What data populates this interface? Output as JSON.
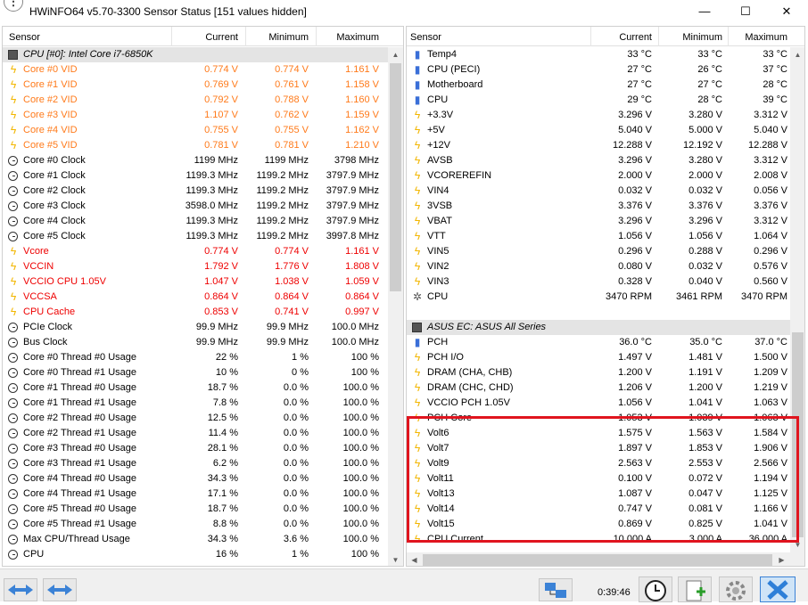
{
  "window": {
    "title": "HWiNFO64 v5.70-3300 Sensor Status [151 values hidden]",
    "minimize": "—",
    "maximize": "☐",
    "close": "✕"
  },
  "columns": {
    "sensor": "Sensor",
    "current": "Current",
    "minimum": "Minimum",
    "maximum": "Maximum"
  },
  "left_rows": [
    {
      "type": "group",
      "icon": "chip",
      "name": "CPU [#0]: Intel Core i7-6850K",
      "cur": "",
      "min": "",
      "max": ""
    },
    {
      "icon": "bolt",
      "color": "orange",
      "name": "Core #0 VID",
      "cur": "0.774 V",
      "min": "0.774 V",
      "max": "1.161 V"
    },
    {
      "icon": "bolt",
      "color": "orange",
      "name": "Core #1 VID",
      "cur": "0.769 V",
      "min": "0.761 V",
      "max": "1.158 V"
    },
    {
      "icon": "bolt",
      "color": "orange",
      "name": "Core #2 VID",
      "cur": "0.792 V",
      "min": "0.788 V",
      "max": "1.160 V"
    },
    {
      "icon": "bolt",
      "color": "orange",
      "name": "Core #3 VID",
      "cur": "1.107 V",
      "min": "0.762 V",
      "max": "1.159 V"
    },
    {
      "icon": "bolt",
      "color": "orange",
      "name": "Core #4 VID",
      "cur": "0.755 V",
      "min": "0.755 V",
      "max": "1.162 V"
    },
    {
      "icon": "bolt",
      "color": "orange",
      "name": "Core #5 VID",
      "cur": "0.781 V",
      "min": "0.781 V",
      "max": "1.210 V"
    },
    {
      "icon": "clock",
      "color": "",
      "name": "Core #0 Clock",
      "cur": "1199 MHz",
      "min": "1199 MHz",
      "max": "3798 MHz"
    },
    {
      "icon": "clock",
      "color": "",
      "name": "Core #1 Clock",
      "cur": "1199.3 MHz",
      "min": "1199.2 MHz",
      "max": "3797.9 MHz"
    },
    {
      "icon": "clock",
      "color": "",
      "name": "Core #2 Clock",
      "cur": "1199.3 MHz",
      "min": "1199.2 MHz",
      "max": "3797.9 MHz"
    },
    {
      "icon": "clock",
      "color": "",
      "name": "Core #3 Clock",
      "cur": "3598.0 MHz",
      "min": "1199.2 MHz",
      "max": "3797.9 MHz"
    },
    {
      "icon": "clock",
      "color": "",
      "name": "Core #4 Clock",
      "cur": "1199.3 MHz",
      "min": "1199.2 MHz",
      "max": "3797.9 MHz"
    },
    {
      "icon": "clock",
      "color": "",
      "name": "Core #5 Clock",
      "cur": "1199.3 MHz",
      "min": "1199.2 MHz",
      "max": "3997.8 MHz"
    },
    {
      "icon": "bolt",
      "color": "red",
      "name": "Vcore",
      "cur": "0.774 V",
      "min": "0.774 V",
      "max": "1.161 V"
    },
    {
      "icon": "bolt",
      "color": "red",
      "name": "VCCIN",
      "cur": "1.792 V",
      "min": "1.776 V",
      "max": "1.808 V"
    },
    {
      "icon": "bolt",
      "color": "red",
      "name": "VCCIO CPU 1.05V",
      "cur": "1.047 V",
      "min": "1.038 V",
      "max": "1.059 V"
    },
    {
      "icon": "bolt",
      "color": "red",
      "name": "VCCSA",
      "cur": "0.864 V",
      "min": "0.864 V",
      "max": "0.864 V"
    },
    {
      "icon": "bolt",
      "color": "red",
      "name": "CPU Cache",
      "cur": "0.853 V",
      "min": "0.741 V",
      "max": "0.997 V"
    },
    {
      "icon": "clock",
      "color": "",
      "name": "PCIe Clock",
      "cur": "99.9 MHz",
      "min": "99.9 MHz",
      "max": "100.0 MHz"
    },
    {
      "icon": "clock",
      "color": "",
      "name": "Bus Clock",
      "cur": "99.9 MHz",
      "min": "99.9 MHz",
      "max": "100.0 MHz"
    },
    {
      "icon": "clock",
      "color": "",
      "name": "Core #0 Thread #0 Usage",
      "cur": "22 %",
      "min": "1 %",
      "max": "100 %"
    },
    {
      "icon": "clock",
      "color": "",
      "name": "Core #0 Thread #1 Usage",
      "cur": "10 %",
      "min": "0 %",
      "max": "100 %"
    },
    {
      "icon": "clock",
      "color": "",
      "name": "Core #1 Thread #0 Usage",
      "cur": "18.7 %",
      "min": "0.0 %",
      "max": "100.0 %"
    },
    {
      "icon": "clock",
      "color": "",
      "name": "Core #1 Thread #1 Usage",
      "cur": "7.8 %",
      "min": "0.0 %",
      "max": "100.0 %"
    },
    {
      "icon": "clock",
      "color": "",
      "name": "Core #2 Thread #0 Usage",
      "cur": "12.5 %",
      "min": "0.0 %",
      "max": "100.0 %"
    },
    {
      "icon": "clock",
      "color": "",
      "name": "Core #2 Thread #1 Usage",
      "cur": "11.4 %",
      "min": "0.0 %",
      "max": "100.0 %"
    },
    {
      "icon": "clock",
      "color": "",
      "name": "Core #3 Thread #0 Usage",
      "cur": "28.1 %",
      "min": "0.0 %",
      "max": "100.0 %"
    },
    {
      "icon": "clock",
      "color": "",
      "name": "Core #3 Thread #1 Usage",
      "cur": "6.2 %",
      "min": "0.0 %",
      "max": "100.0 %"
    },
    {
      "icon": "clock",
      "color": "",
      "name": "Core #4 Thread #0 Usage",
      "cur": "34.3 %",
      "min": "0.0 %",
      "max": "100.0 %"
    },
    {
      "icon": "clock",
      "color": "",
      "name": "Core #4 Thread #1 Usage",
      "cur": "17.1 %",
      "min": "0.0 %",
      "max": "100.0 %"
    },
    {
      "icon": "clock",
      "color": "",
      "name": "Core #5 Thread #0 Usage",
      "cur": "18.7 %",
      "min": "0.0 %",
      "max": "100.0 %"
    },
    {
      "icon": "clock",
      "color": "",
      "name": "Core #5 Thread #1 Usage",
      "cur": "8.8 %",
      "min": "0.0 %",
      "max": "100.0 %"
    },
    {
      "icon": "clock",
      "color": "",
      "name": "Max CPU/Thread Usage",
      "cur": "34.3 %",
      "min": "3.6 %",
      "max": "100.0 %"
    },
    {
      "icon": "clock",
      "color": "",
      "name": "CPU",
      "cur": "16 %",
      "min": "1 %",
      "max": "100 %"
    }
  ],
  "right_rows": [
    {
      "icon": "therm",
      "name": "Temp4",
      "cur": "33 °C",
      "min": "33 °C",
      "max": "33 °C"
    },
    {
      "icon": "therm",
      "name": "CPU (PECI)",
      "cur": "27 °C",
      "min": "26 °C",
      "max": "37 °C"
    },
    {
      "icon": "therm",
      "name": "Motherboard",
      "cur": "27 °C",
      "min": "27 °C",
      "max": "28 °C"
    },
    {
      "icon": "therm",
      "name": "CPU",
      "cur": "29 °C",
      "min": "28 °C",
      "max": "39 °C"
    },
    {
      "icon": "bolt",
      "name": "+3.3V",
      "cur": "3.296 V",
      "min": "3.280 V",
      "max": "3.312 V"
    },
    {
      "icon": "bolt",
      "name": "+5V",
      "cur": "5.040 V",
      "min": "5.000 V",
      "max": "5.040 V"
    },
    {
      "icon": "bolt",
      "name": "+12V",
      "cur": "12.288 V",
      "min": "12.192 V",
      "max": "12.288 V"
    },
    {
      "icon": "bolt",
      "name": "AVSB",
      "cur": "3.296 V",
      "min": "3.280 V",
      "max": "3.312 V"
    },
    {
      "icon": "bolt",
      "name": "VCOREREFIN",
      "cur": "2.000 V",
      "min": "2.000 V",
      "max": "2.008 V"
    },
    {
      "icon": "bolt",
      "name": "VIN4",
      "cur": "0.032 V",
      "min": "0.032 V",
      "max": "0.056 V"
    },
    {
      "icon": "bolt",
      "name": "3VSB",
      "cur": "3.376 V",
      "min": "3.376 V",
      "max": "3.376 V"
    },
    {
      "icon": "bolt",
      "name": "VBAT",
      "cur": "3.296 V",
      "min": "3.296 V",
      "max": "3.312 V"
    },
    {
      "icon": "bolt",
      "name": "VTT",
      "cur": "1.056 V",
      "min": "1.056 V",
      "max": "1.064 V"
    },
    {
      "icon": "bolt",
      "name": "VIN5",
      "cur": "0.296 V",
      "min": "0.288 V",
      "max": "0.296 V"
    },
    {
      "icon": "bolt",
      "name": "VIN2",
      "cur": "0.080 V",
      "min": "0.032 V",
      "max": "0.576 V"
    },
    {
      "icon": "bolt",
      "name": "VIN3",
      "cur": "0.328 V",
      "min": "0.040 V",
      "max": "0.560 V"
    },
    {
      "icon": "fan",
      "name": "CPU",
      "cur": "3470 RPM",
      "min": "3461 RPM",
      "max": "3470 RPM"
    },
    {
      "type": "blank"
    },
    {
      "type": "group",
      "icon": "chip",
      "name": "ASUS EC: ASUS All Series",
      "cur": "",
      "min": "",
      "max": ""
    },
    {
      "icon": "therm",
      "name": "PCH",
      "cur": "36.0 °C",
      "min": "35.0 °C",
      "max": "37.0 °C"
    },
    {
      "icon": "bolt",
      "name": "PCH I/O",
      "cur": "1.497 V",
      "min": "1.481 V",
      "max": "1.500 V"
    },
    {
      "icon": "bolt",
      "name": "DRAM (CHA, CHB)",
      "cur": "1.200 V",
      "min": "1.191 V",
      "max": "1.209 V"
    },
    {
      "icon": "bolt",
      "name": "DRAM (CHC, CHD)",
      "cur": "1.206 V",
      "min": "1.200 V",
      "max": "1.219 V"
    },
    {
      "icon": "bolt",
      "name": "VCCIO PCH 1.05V",
      "cur": "1.056 V",
      "min": "1.041 V",
      "max": "1.063 V"
    },
    {
      "icon": "bolt",
      "name": "PCH Core",
      "cur": "1.053 V",
      "min": "1.039 V",
      "max": "1.063 V"
    },
    {
      "icon": "bolt",
      "name": "Volt6",
      "cur": "1.575 V",
      "min": "1.563 V",
      "max": "1.584 V"
    },
    {
      "icon": "bolt",
      "name": "Volt7",
      "cur": "1.897 V",
      "min": "1.853 V",
      "max": "1.906 V"
    },
    {
      "icon": "bolt",
      "name": "Volt9",
      "cur": "2.563 V",
      "min": "2.553 V",
      "max": "2.566 V"
    },
    {
      "icon": "bolt",
      "name": "Volt11",
      "cur": "0.100 V",
      "min": "0.072 V",
      "max": "1.194 V"
    },
    {
      "icon": "bolt",
      "name": "Volt13",
      "cur": "1.087 V",
      "min": "0.047 V",
      "max": "1.125 V"
    },
    {
      "icon": "bolt",
      "name": "Volt14",
      "cur": "0.747 V",
      "min": "0.081 V",
      "max": "1.166 V"
    },
    {
      "icon": "bolt",
      "name": "Volt15",
      "cur": "0.869 V",
      "min": "0.825 V",
      "max": "1.041 V"
    },
    {
      "icon": "bolt",
      "name": "CPU Current",
      "cur": "10.000 A",
      "min": "3.000 A",
      "max": "36.000 A"
    }
  ],
  "toolbar": {
    "elapsed": "0:39:46"
  },
  "colors": {
    "highlight": "#e0141e",
    "orange": "#ff7a1a",
    "red": "#ee0000",
    "bolt": "#f2b600",
    "group_bg": "#e4e4e4"
  }
}
